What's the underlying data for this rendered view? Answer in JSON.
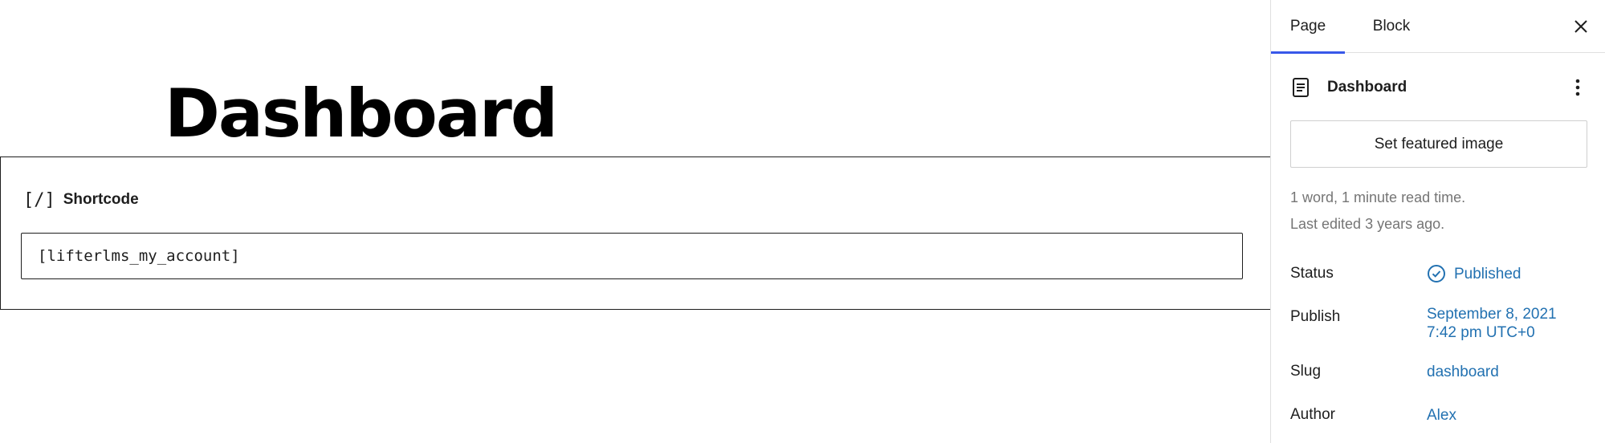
{
  "editor": {
    "page_title": "Dashboard",
    "block": {
      "icon_glyph": "[/]",
      "label": "Shortcode",
      "value": "[lifterlms_my_account]"
    }
  },
  "sidebar": {
    "tabs": [
      {
        "label": "Page",
        "active": true
      },
      {
        "label": "Block",
        "active": false
      }
    ],
    "document": {
      "title": "Dashboard",
      "featured_image_button": "Set featured image",
      "word_count": "1 word, 1 minute read time.",
      "last_edited": "Last edited 3 years ago."
    },
    "properties": {
      "status": {
        "label": "Status",
        "value": "Published"
      },
      "publish": {
        "label": "Publish",
        "date": "September 8, 2021",
        "time": "7:42 pm UTC+0"
      },
      "slug": {
        "label": "Slug",
        "value": "dashboard"
      },
      "author": {
        "label": "Author",
        "value": "Alex"
      }
    },
    "icons": [
      "close-icon",
      "page-icon",
      "more-vertical-icon",
      "published-check-icon"
    ],
    "colors": {
      "accent": "#3858e9",
      "link": "#2271b1",
      "muted": "#757575",
      "text": "#1e1e1e"
    }
  }
}
